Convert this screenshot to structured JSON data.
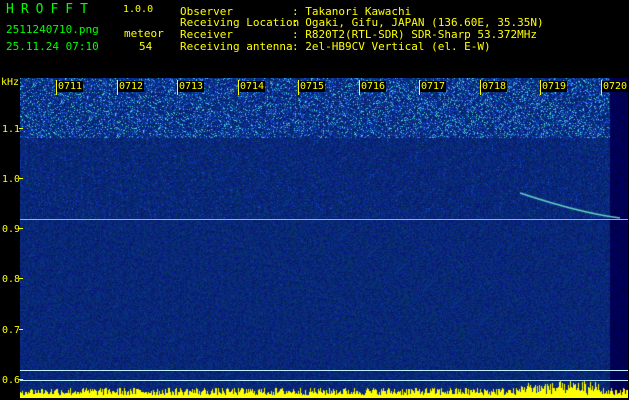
{
  "app": {
    "title": "HROFFT",
    "version": "1.0.0"
  },
  "file": {
    "name": "2511240710.png",
    "datetime": "25.11.24 07:10"
  },
  "meteor": {
    "label": "meteor",
    "count": "54"
  },
  "station": {
    "observer_label": "Observer",
    "observer_value": ": Takanori Kawachi",
    "location_label": "Receiving Location",
    "location_value": ": Ogaki, Gifu, JAPAN (136.60E, 35.35N)",
    "receiver_label": "Receiver",
    "receiver_value": ": R820T2(RTL-SDR) SDR-Sharp 53.372MHz",
    "antenna_label": "Receiving antenna",
    "antenna_value": ": 2el-HB9CV Vertical (el. E-W)"
  },
  "axis": {
    "unit": "kHz",
    "ticks": [
      "1.1",
      "1.0",
      "0.9",
      "0.8",
      "0.7",
      "0.6"
    ]
  },
  "timeline": {
    "labels": [
      "0711",
      "0712",
      "0713",
      "0714",
      "0715",
      "0716",
      "0717",
      "0718",
      "0719",
      "0720"
    ]
  },
  "colors": {
    "label": "#00ff00",
    "value": "#ffff00",
    "background": "#000000",
    "spectrogram_base": "#0a1f8c",
    "carrier": "#39e0d0",
    "ref_line": "#bfefff"
  }
}
